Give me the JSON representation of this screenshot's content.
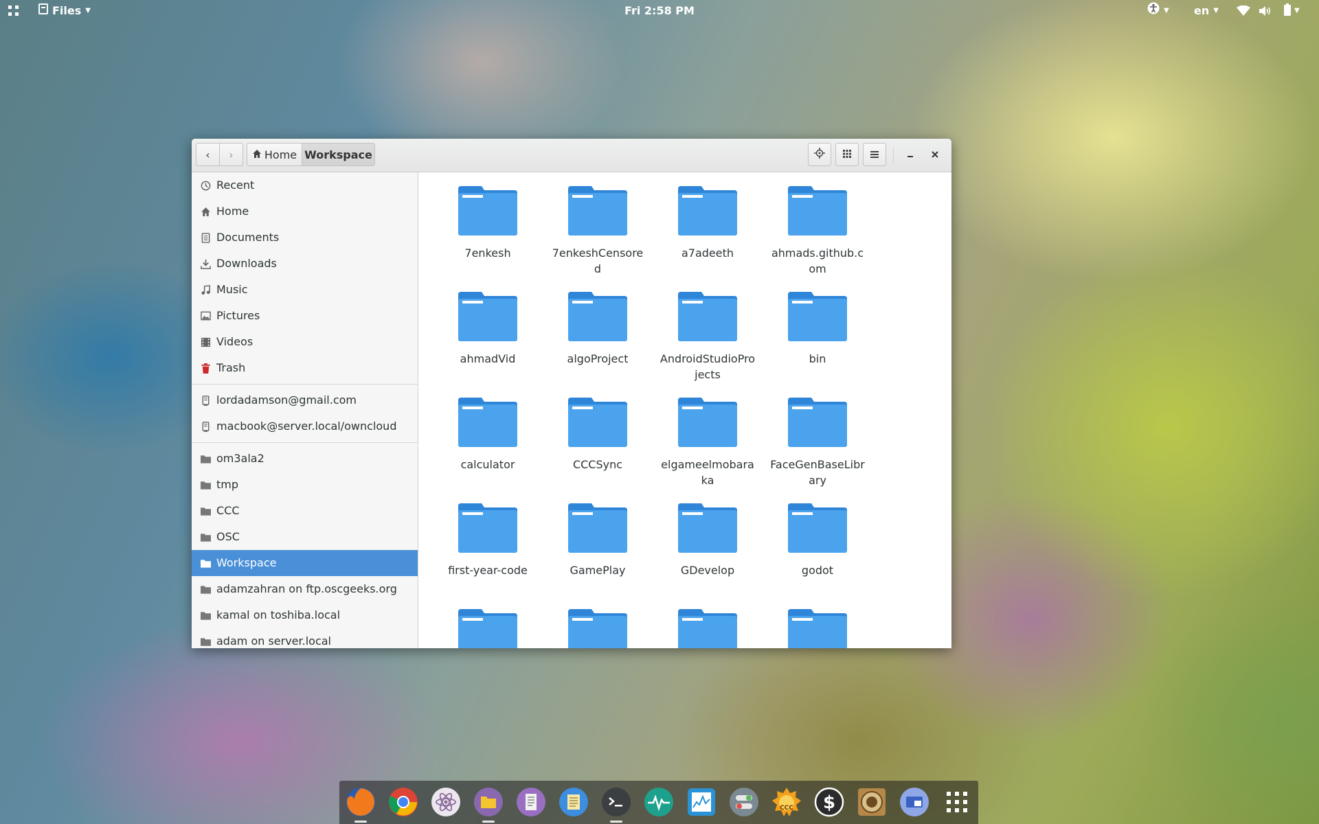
{
  "topbar": {
    "app_menu_label": "Files",
    "clock": "Fri  2:58 PM",
    "language": "en"
  },
  "window": {
    "breadcrumb": {
      "home_label": "Home",
      "current_label": "Workspace"
    }
  },
  "sidebar": {
    "places": [
      {
        "label": "Recent",
        "icon": "clock-icon"
      },
      {
        "label": "Home",
        "icon": "home-icon"
      },
      {
        "label": "Documents",
        "icon": "document-icon"
      },
      {
        "label": "Downloads",
        "icon": "download-icon"
      },
      {
        "label": "Music",
        "icon": "music-icon"
      },
      {
        "label": "Pictures",
        "icon": "picture-icon"
      },
      {
        "label": "Videos",
        "icon": "video-icon"
      },
      {
        "label": "Trash",
        "icon": "trash-icon"
      }
    ],
    "accounts": [
      {
        "label": "lordadamson@gmail.com",
        "icon": "network-drive-icon"
      },
      {
        "label": "macbook@server.local/owncloud",
        "icon": "network-drive-icon"
      }
    ],
    "bookmarks": [
      {
        "label": "om3ala2",
        "icon": "folder-icon"
      },
      {
        "label": "tmp",
        "icon": "folder-icon"
      },
      {
        "label": "CCC",
        "icon": "folder-icon"
      },
      {
        "label": "OSC",
        "icon": "folder-icon"
      },
      {
        "label": "Workspace",
        "icon": "folder-icon",
        "active": true
      },
      {
        "label": "adamzahran on ftp.oscgeeks.org",
        "icon": "folder-icon"
      },
      {
        "label": "kamal on toshiba.local",
        "icon": "folder-icon"
      },
      {
        "label": "adam on server.local",
        "icon": "folder-icon"
      }
    ]
  },
  "files": [
    "7enkesh",
    "7enkeshCensored",
    "a7adeeth",
    "ahmads.github.com",
    "ahmadVid",
    "algoProject",
    "AndroidStudioProjects",
    "bin",
    "calculator",
    "CCCSync",
    "elgameelmobaraka",
    "FaceGenBaseLibrary",
    "first-year-code",
    "GamePlay",
    "GDevelop",
    "godot",
    "",
    "",
    "",
    ""
  ],
  "dock": [
    {
      "name": "firefox-icon",
      "color": "#e8622a",
      "running": true
    },
    {
      "name": "chrome-icon",
      "color": "#dd4b39",
      "running": false
    },
    {
      "name": "atom-icon",
      "color": "#e9e4ec",
      "running": false
    },
    {
      "name": "files-icon",
      "color": "#8e6cb0",
      "running": true
    },
    {
      "name": "text-editor-icon",
      "color": "#9b72c0",
      "running": false
    },
    {
      "name": "notes-icon",
      "color": "#4a8fd8",
      "running": false
    },
    {
      "name": "terminal-icon",
      "color": "#3c3f41",
      "running": true
    },
    {
      "name": "system-monitor-icon",
      "color": "#1fa58f",
      "running": false
    },
    {
      "name": "activity-monitor-icon",
      "color": "#2a93d5",
      "running": false
    },
    {
      "name": "tweaks-icon",
      "color": "#7d8b93",
      "running": false
    },
    {
      "name": "ccc-icon",
      "color": "#f0a020",
      "running": false
    },
    {
      "name": "money-icon",
      "color": "#2d2d2d",
      "running": false
    },
    {
      "name": "quran-icon",
      "color": "#b88a3c",
      "running": false
    },
    {
      "name": "window-switcher-icon",
      "color": "#5b7fd6",
      "running": false
    },
    {
      "name": "app-grid-icon",
      "color": "transparent",
      "running": false
    }
  ],
  "colors": {
    "accent": "#4a90d9",
    "folder": "#4aa3ec"
  }
}
